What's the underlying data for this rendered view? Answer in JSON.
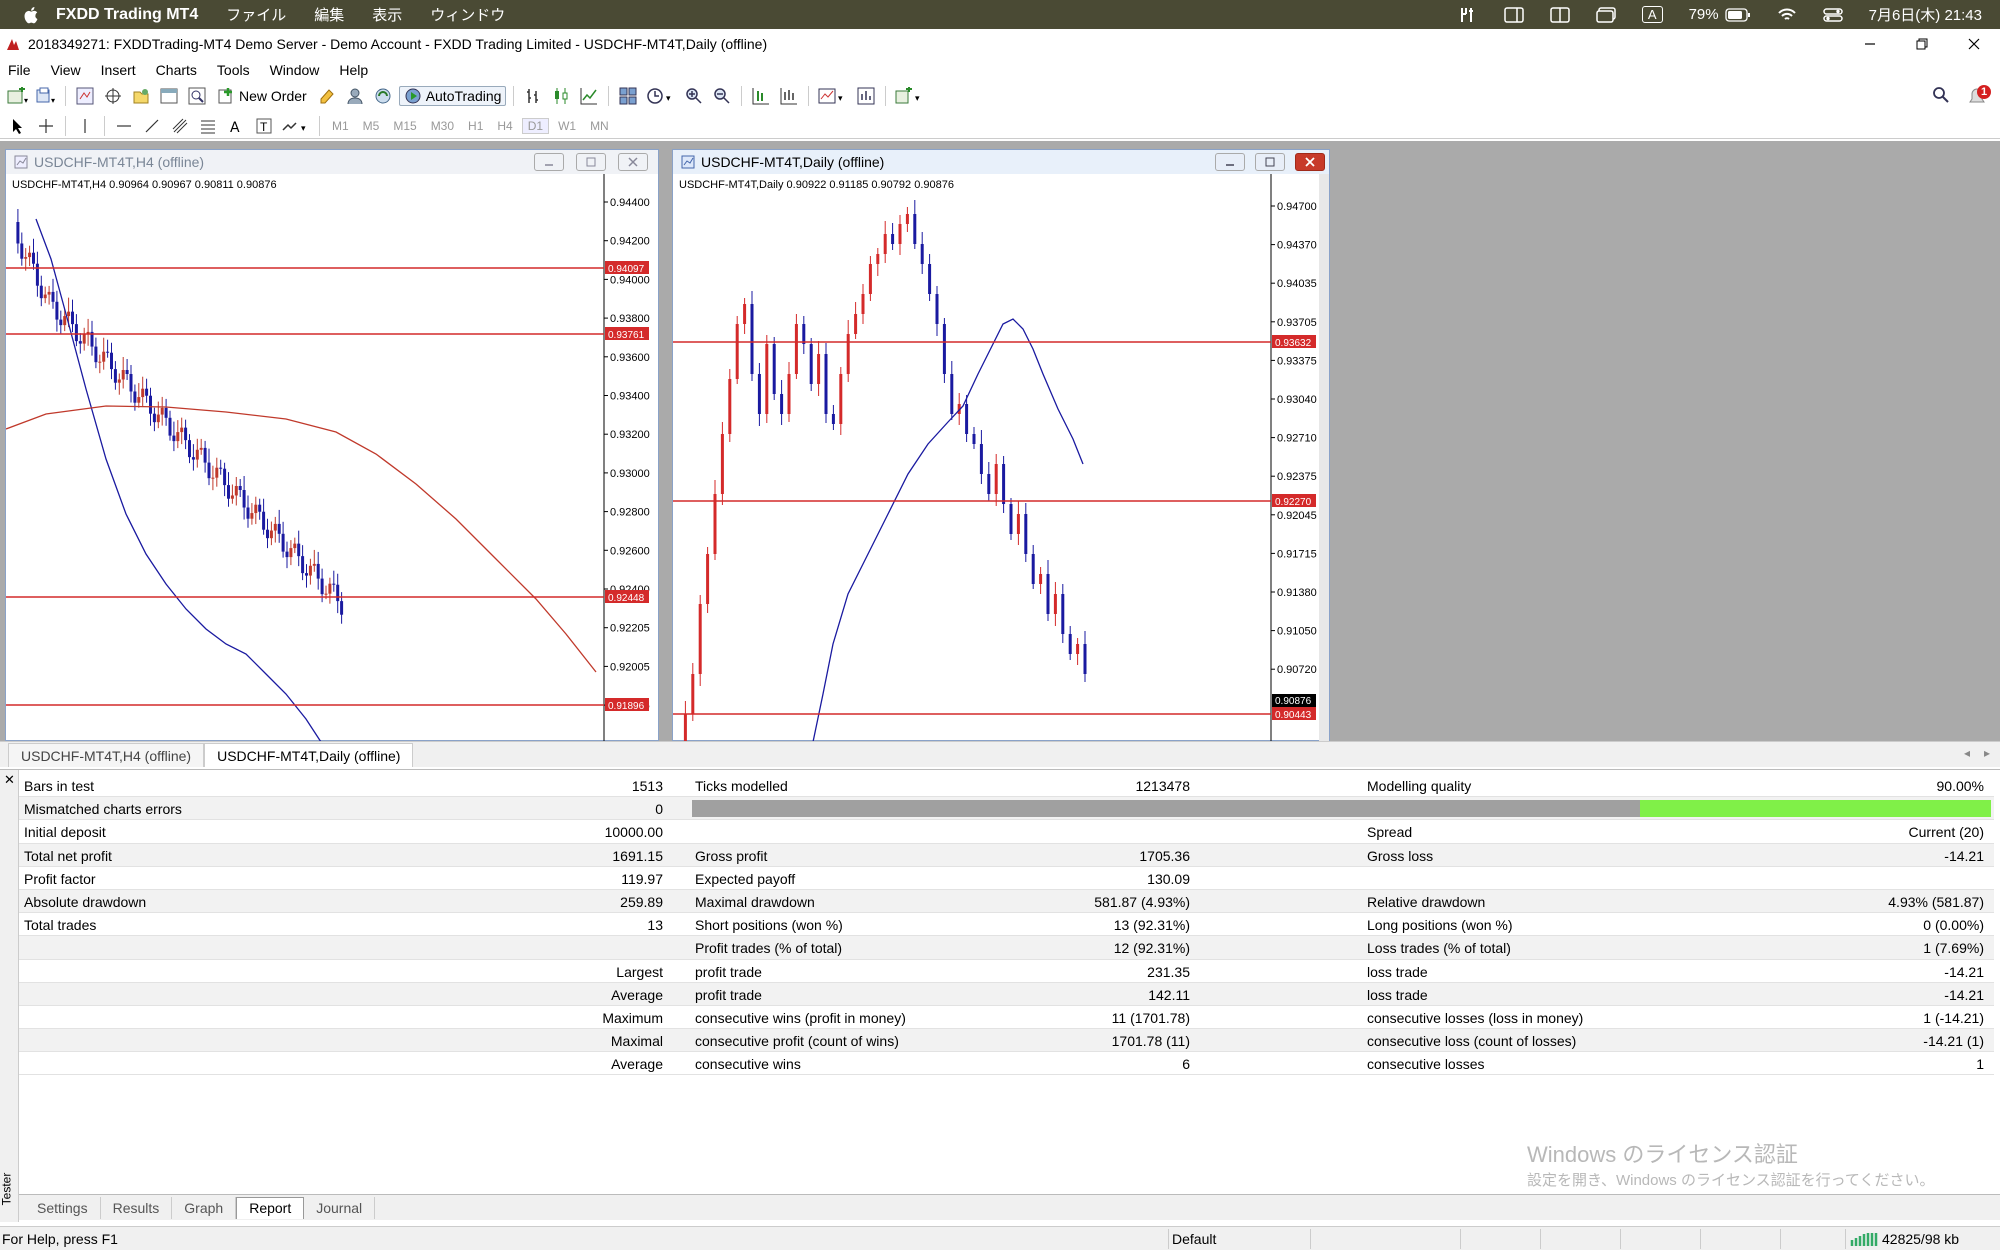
{
  "macbar": {
    "app_name": "FXDD Trading MT4",
    "menus": [
      "ファイル",
      "編集",
      "表示",
      "ウィンドウ"
    ],
    "battery": "79%",
    "datetime": "7月6日(木) 21:43",
    "input_mode": "A"
  },
  "window": {
    "title": "2018349271: FXDDTrading-MT4 Demo Server - Demo Account - FXDD Trading Limited - USDCHF-MT4T,Daily (offline)"
  },
  "menubar": {
    "items": [
      "File",
      "View",
      "Insert",
      "Charts",
      "Tools",
      "Window",
      "Help"
    ]
  },
  "toolbar": {
    "new_order": "New Order",
    "autotrading": "AutoTrading",
    "timeframes": [
      "M1",
      "M5",
      "M15",
      "M30",
      "H1",
      "H4",
      "D1",
      "W1",
      "MN"
    ],
    "notification_count": "1"
  },
  "chartA": {
    "window_title": "USDCHF-MT4T,H4 (offline)",
    "info": "USDCHF-MT4T,H4  0.90964 0.90967 0.90811 0.90876",
    "price_labels": [
      "0.94400",
      "0.94200",
      "0.94000",
      "0.93800",
      "0.93600",
      "0.93400",
      "0.93200",
      "0.93000",
      "0.92800",
      "0.92600",
      "0.92400",
      "0.92205",
      "0.92005",
      "0.91805"
    ],
    "level_tags": [
      "0.94097",
      "0.93761",
      "0.92448",
      "0.91896"
    ]
  },
  "chartB": {
    "window_title": "USDCHF-MT4T,Daily (offline)",
    "info": "USDCHF-MT4T,Daily  0.90922 0.91185 0.90792 0.90876",
    "price_labels": [
      "0.94700",
      "0.94370",
      "0.94035",
      "0.93705",
      "0.93375",
      "0.93040",
      "0.92710",
      "0.92375",
      "0.92045",
      "0.91715",
      "0.91380",
      "0.91050",
      "0.90720"
    ],
    "level_tags": [
      "0.93632",
      "0.92270",
      "0.90443"
    ],
    "current_price": "0.90876"
  },
  "chart_tabs": [
    "USDCHF-MT4T,H4 (offline)",
    "USDCHF-MT4T,Daily (offline)"
  ],
  "report": {
    "rows": [
      [
        "Bars in test",
        "1513",
        "Ticks modelled",
        "1213478",
        "Modelling quality",
        "90.00%"
      ],
      [
        "Mismatched charts errors",
        "0",
        "",
        "",
        "",
        ""
      ],
      [
        "Initial deposit",
        "10000.00",
        "",
        "",
        "Spread",
        "Current (20)"
      ],
      [
        "Total net profit",
        "1691.15",
        "Gross profit",
        "1705.36",
        "Gross loss",
        "-14.21"
      ],
      [
        "Profit factor",
        "119.97",
        "Expected payoff",
        "130.09",
        "",
        ""
      ],
      [
        "Absolute drawdown",
        "259.89",
        "Maximal drawdown",
        "581.87 (4.93%)",
        "Relative drawdown",
        "4.93% (581.87)"
      ],
      [
        "Total trades",
        "13",
        "Short positions (won %)",
        "13 (92.31%)",
        "Long positions (won %)",
        "0 (0.00%)"
      ],
      [
        "",
        "",
        "Profit trades (% of total)",
        "12 (92.31%)",
        "Loss trades (% of total)",
        "1 (7.69%)"
      ],
      [
        "",
        "Largest",
        "profit trade",
        "231.35",
        "loss trade",
        "-14.21"
      ],
      [
        "",
        "Average",
        "profit trade",
        "142.11",
        "loss trade",
        "-14.21"
      ],
      [
        "",
        "Maximum",
        "consecutive wins (profit in money)",
        "11 (1701.78)",
        "consecutive losses (loss in money)",
        "1 (-14.21)"
      ],
      [
        "",
        "Maximal",
        "consecutive profit (count of wins)",
        "1701.78 (11)",
        "consecutive loss (count of losses)",
        "-14.21 (1)"
      ],
      [
        "",
        "Average",
        "consecutive wins",
        "6",
        "consecutive losses",
        "1"
      ]
    ],
    "modelling_quality_fraction": 0.27
  },
  "watermark": {
    "line1": "Windows のライセンス認証",
    "line2": "設定を開き、Windows のライセンス認証を行ってください。"
  },
  "tester": {
    "side_label": "Tester",
    "tabs": [
      "Settings",
      "Results",
      "Graph",
      "Report",
      "Journal"
    ],
    "active_tab": "Report"
  },
  "statusbar": {
    "help": "For Help, press F1",
    "profile": "Default",
    "traffic": "42825/98 kb"
  }
}
